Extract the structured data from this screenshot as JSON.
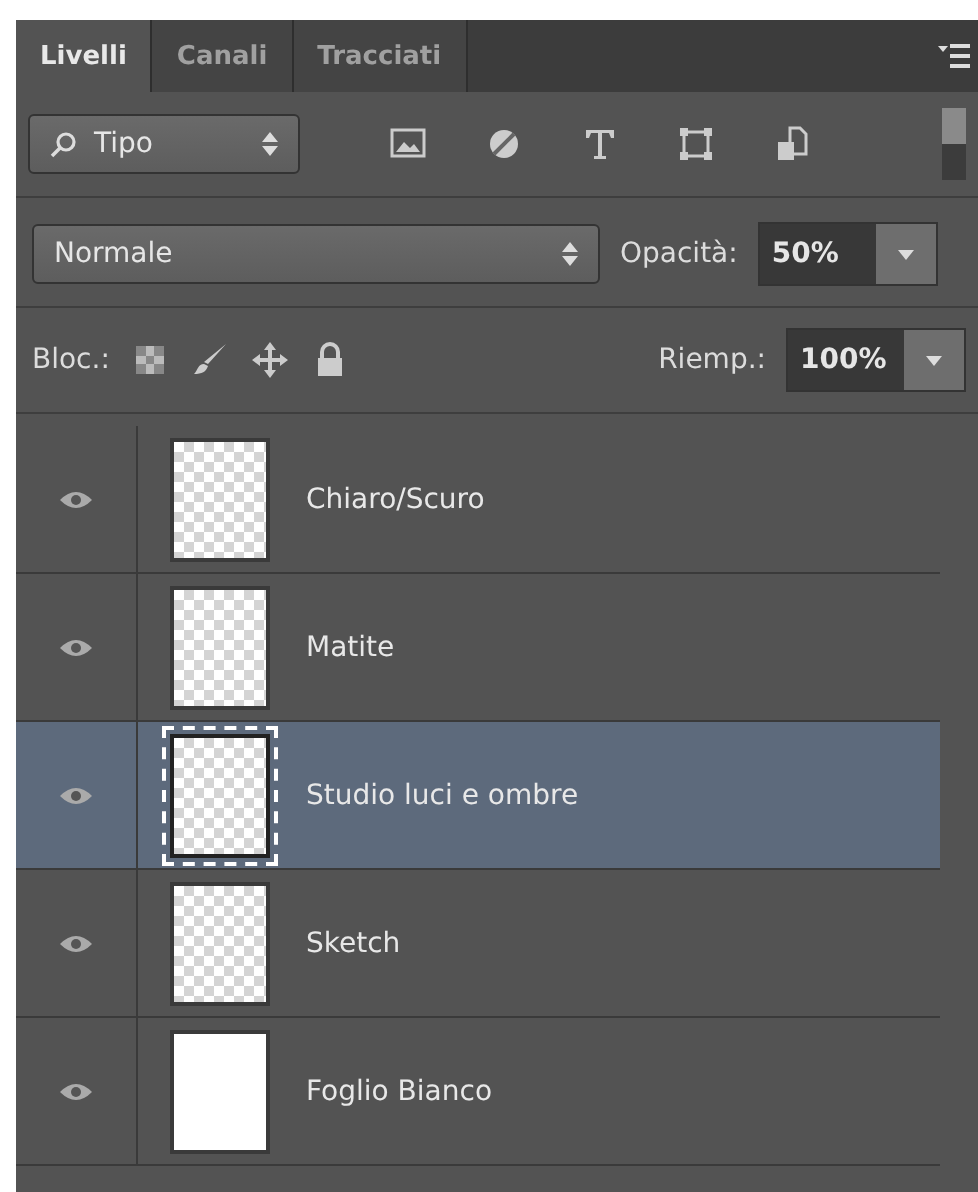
{
  "tabs": [
    {
      "label": "Livelli",
      "selected": true
    },
    {
      "label": "Canali",
      "selected": false
    },
    {
      "label": "Tracciati",
      "selected": false
    }
  ],
  "filter": {
    "value": "Tipo"
  },
  "blend_mode": {
    "value": "Normale"
  },
  "opacity": {
    "label": "Opacità:",
    "value": "50%"
  },
  "lock": {
    "label": "Bloc.:"
  },
  "fill": {
    "label": "Riemp.:",
    "value": "100%"
  },
  "layers": [
    {
      "name": "Chiaro/Scuro",
      "visible": true,
      "selected": false,
      "kind": "transparent"
    },
    {
      "name": "Matite",
      "visible": true,
      "selected": false,
      "kind": "transparent"
    },
    {
      "name": "Studio luci e ombre",
      "visible": true,
      "selected": true,
      "kind": "transparent"
    },
    {
      "name": "Sketch",
      "visible": true,
      "selected": false,
      "kind": "transparent"
    },
    {
      "name": "Foglio Bianco",
      "visible": true,
      "selected": false,
      "kind": "white"
    }
  ]
}
